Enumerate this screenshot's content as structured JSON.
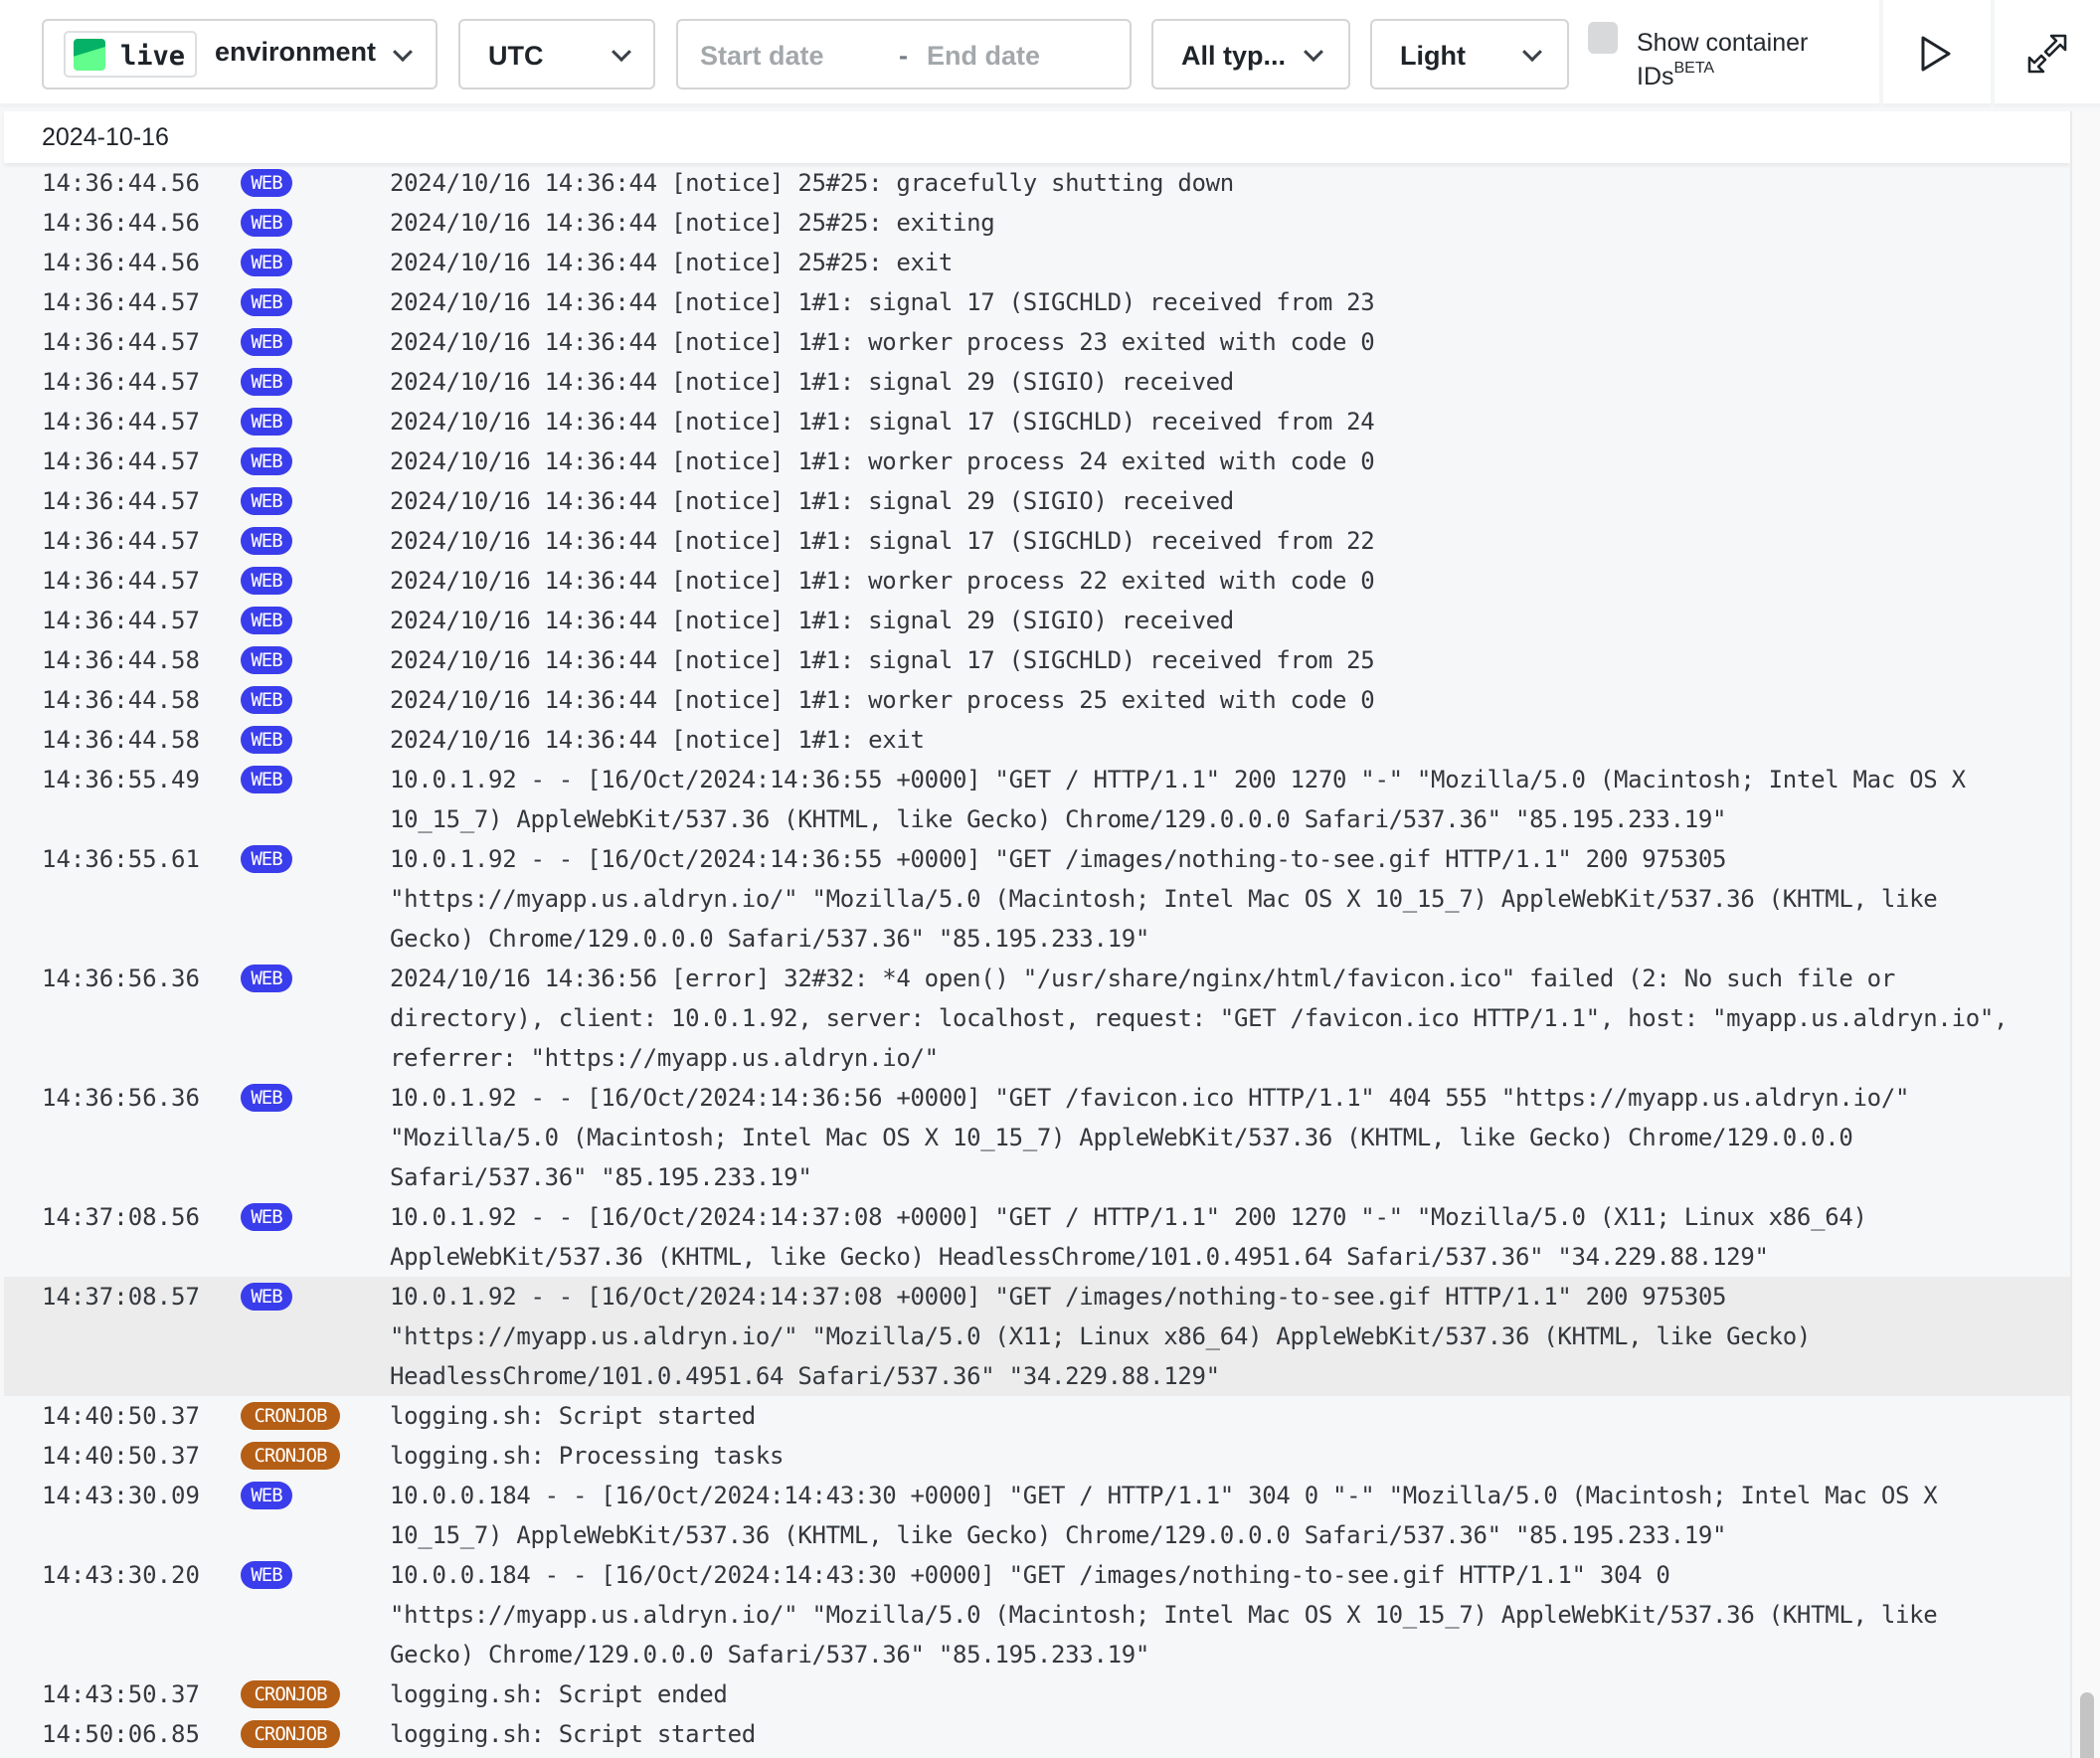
{
  "toolbar": {
    "environment": {
      "name": "live",
      "label": "environment",
      "swatch_colors": [
        "#05b166",
        "#63fd8d"
      ]
    },
    "timezone": "UTC",
    "date_range": {
      "start_placeholder": "Start date",
      "separator": "-",
      "end_placeholder": "End date"
    },
    "log_types": "All typ...",
    "theme": "Light",
    "show_container_ids": {
      "label": "Show container IDs",
      "badge": "BETA",
      "checked": false
    },
    "play_icon": "play-icon",
    "expand_icon": "expand-icon"
  },
  "log": {
    "date": "2024-10-16",
    "badge_colors": {
      "WEB": "#3a3deb",
      "CRONJOB": "#b55e15"
    },
    "entries": [
      {
        "time": "14:36:44.56",
        "type": "WEB",
        "message": "2024/10/16 14:36:44 [notice] 25#25: gracefully shutting down"
      },
      {
        "time": "14:36:44.56",
        "type": "WEB",
        "message": "2024/10/16 14:36:44 [notice] 25#25: exiting"
      },
      {
        "time": "14:36:44.56",
        "type": "WEB",
        "message": "2024/10/16 14:36:44 [notice] 25#25: exit"
      },
      {
        "time": "14:36:44.57",
        "type": "WEB",
        "message": "2024/10/16 14:36:44 [notice] 1#1: signal 17 (SIGCHLD) received from 23"
      },
      {
        "time": "14:36:44.57",
        "type": "WEB",
        "message": "2024/10/16 14:36:44 [notice] 1#1: worker process 23 exited with code 0"
      },
      {
        "time": "14:36:44.57",
        "type": "WEB",
        "message": "2024/10/16 14:36:44 [notice] 1#1: signal 29 (SIGIO) received"
      },
      {
        "time": "14:36:44.57",
        "type": "WEB",
        "message": "2024/10/16 14:36:44 [notice] 1#1: signal 17 (SIGCHLD) received from 24"
      },
      {
        "time": "14:36:44.57",
        "type": "WEB",
        "message": "2024/10/16 14:36:44 [notice] 1#1: worker process 24 exited with code 0"
      },
      {
        "time": "14:36:44.57",
        "type": "WEB",
        "message": "2024/10/16 14:36:44 [notice] 1#1: signal 29 (SIGIO) received"
      },
      {
        "time": "14:36:44.57",
        "type": "WEB",
        "message": "2024/10/16 14:36:44 [notice] 1#1: signal 17 (SIGCHLD) received from 22"
      },
      {
        "time": "14:36:44.57",
        "type": "WEB",
        "message": "2024/10/16 14:36:44 [notice] 1#1: worker process 22 exited with code 0"
      },
      {
        "time": "14:36:44.57",
        "type": "WEB",
        "message": "2024/10/16 14:36:44 [notice] 1#1: signal 29 (SIGIO) received"
      },
      {
        "time": "14:36:44.58",
        "type": "WEB",
        "message": "2024/10/16 14:36:44 [notice] 1#1: signal 17 (SIGCHLD) received from 25"
      },
      {
        "time": "14:36:44.58",
        "type": "WEB",
        "message": "2024/10/16 14:36:44 [notice] 1#1: worker process 25 exited with code 0"
      },
      {
        "time": "14:36:44.58",
        "type": "WEB",
        "message": "2024/10/16 14:36:44 [notice] 1#1: exit"
      },
      {
        "time": "14:36:55.49",
        "type": "WEB",
        "message": "10.0.1.92 - - [16/Oct/2024:14:36:55 +0000] \"GET / HTTP/1.1\" 200 1270 \"-\" \"Mozilla/5.0 (Macintosh; Intel Mac OS X 10_15_7) AppleWebKit/537.36 (KHTML, like Gecko) Chrome/129.0.0.0 Safari/537.36\" \"85.195.233.19\""
      },
      {
        "time": "14:36:55.61",
        "type": "WEB",
        "message": "10.0.1.92 - - [16/Oct/2024:14:36:55 +0000] \"GET /images/nothing-to-see.gif HTTP/1.1\" 200 975305 \"https://myapp.us.aldryn.io/\" \"Mozilla/5.0 (Macintosh; Intel Mac OS X 10_15_7) AppleWebKit/537.36 (KHTML, like Gecko) Chrome/129.0.0.0 Safari/537.36\" \"85.195.233.19\""
      },
      {
        "time": "14:36:56.36",
        "type": "WEB",
        "message": "2024/10/16 14:36:56 [error] 32#32: *4 open() \"/usr/share/nginx/html/favicon.ico\" failed (2: No such file or directory), client: 10.0.1.92, server: localhost, request: \"GET /favicon.ico HTTP/1.1\", host: \"myapp.us.aldryn.io\", referrer: \"https://myapp.us.aldryn.io/\""
      },
      {
        "time": "14:36:56.36",
        "type": "WEB",
        "message": "10.0.1.92 - - [16/Oct/2024:14:36:56 +0000] \"GET /favicon.ico HTTP/1.1\" 404 555 \"https://myapp.us.aldryn.io/\" \"Mozilla/5.0 (Macintosh; Intel Mac OS X 10_15_7) AppleWebKit/537.36 (KHTML, like Gecko) Chrome/129.0.0.0 Safari/537.36\" \"85.195.233.19\""
      },
      {
        "time": "14:37:08.56",
        "type": "WEB",
        "message": "10.0.1.92 - - [16/Oct/2024:14:37:08 +0000] \"GET / HTTP/1.1\" 200 1270 \"-\" \"Mozilla/5.0 (X11; Linux x86_64) AppleWebKit/537.36 (KHTML, like Gecko) HeadlessChrome/101.0.4951.64 Safari/537.36\" \"34.229.88.129\""
      },
      {
        "time": "14:37:08.57",
        "type": "WEB",
        "highlighted": true,
        "message": "10.0.1.92 - - [16/Oct/2024:14:37:08 +0000] \"GET /images/nothing-to-see.gif HTTP/1.1\" 200 975305 \"https://myapp.us.aldryn.io/\" \"Mozilla/5.0 (X11; Linux x86_64) AppleWebKit/537.36 (KHTML, like Gecko) HeadlessChrome/101.0.4951.64 Safari/537.36\" \"34.229.88.129\""
      },
      {
        "time": "14:40:50.37",
        "type": "CRONJOB",
        "message": "logging.sh: Script started"
      },
      {
        "time": "14:40:50.37",
        "type": "CRONJOB",
        "message": "logging.sh: Processing tasks"
      },
      {
        "time": "14:43:30.09",
        "type": "WEB",
        "message": "10.0.0.184 - - [16/Oct/2024:14:43:30 +0000] \"GET / HTTP/1.1\" 304 0 \"-\" \"Mozilla/5.0 (Macintosh; Intel Mac OS X 10_15_7) AppleWebKit/537.36 (KHTML, like Gecko) Chrome/129.0.0.0 Safari/537.36\" \"85.195.233.19\""
      },
      {
        "time": "14:43:30.20",
        "type": "WEB",
        "message": "10.0.0.184 - - [16/Oct/2024:14:43:30 +0000] \"GET /images/nothing-to-see.gif HTTP/1.1\" 304 0 \"https://myapp.us.aldryn.io/\" \"Mozilla/5.0 (Macintosh; Intel Mac OS X 10_15_7) AppleWebKit/537.36 (KHTML, like Gecko) Chrome/129.0.0.0 Safari/537.36\" \"85.195.233.19\""
      },
      {
        "time": "14:43:50.37",
        "type": "CRONJOB",
        "message": "logging.sh: Script ended"
      },
      {
        "time": "14:50:06.85",
        "type": "CRONJOB",
        "message": "logging.sh: Script started"
      }
    ]
  }
}
